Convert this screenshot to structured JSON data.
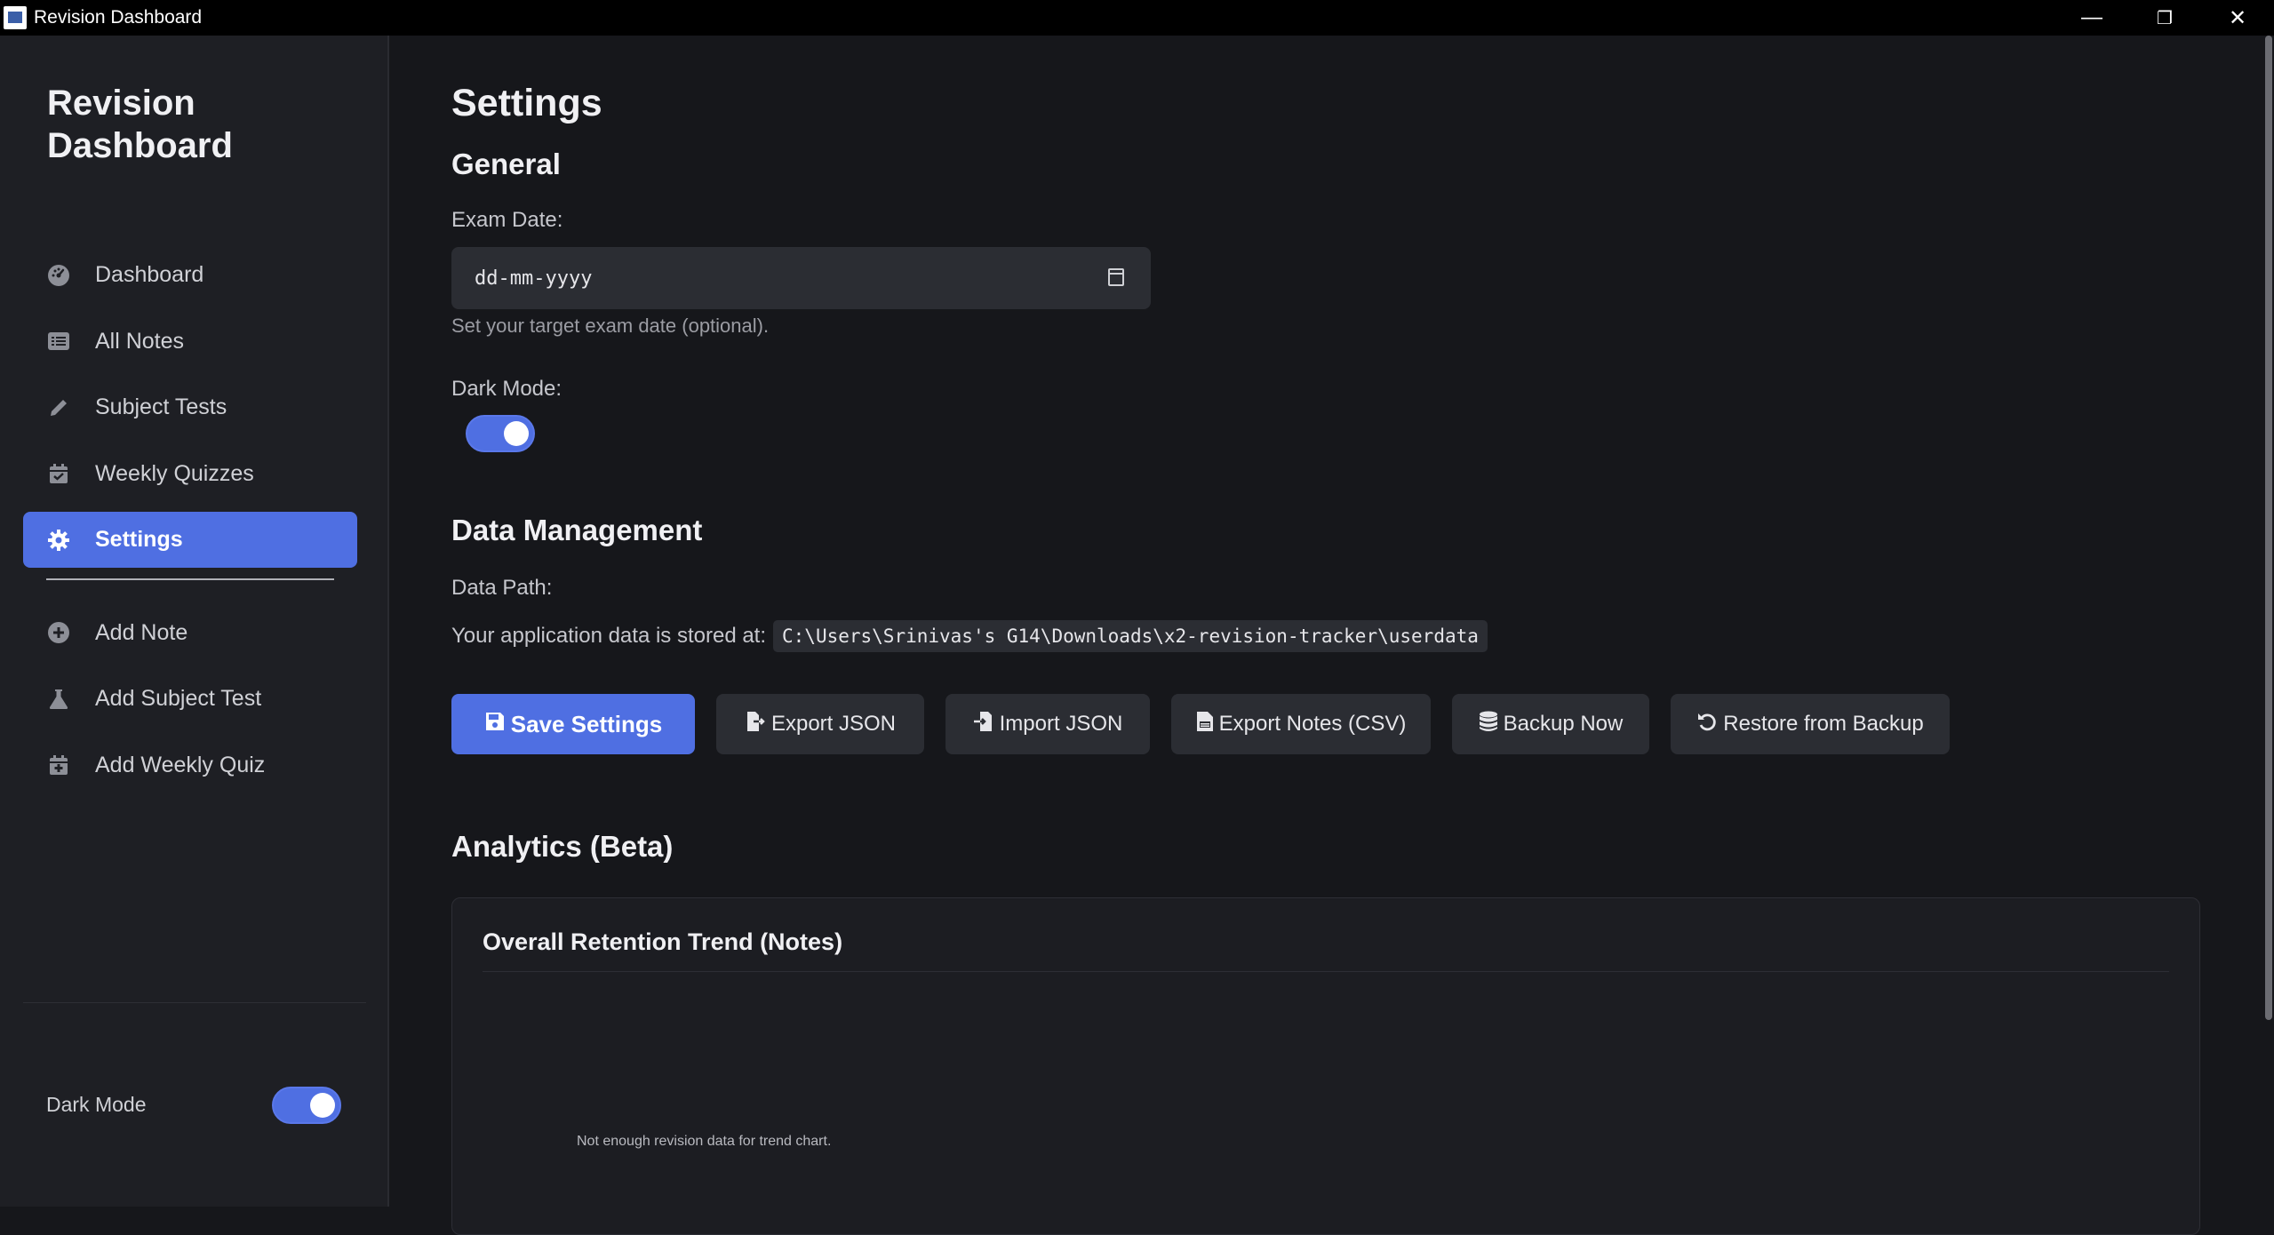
{
  "window": {
    "title": "Revision Dashboard",
    "controls": {
      "minimize": "—",
      "restore": "❐",
      "close": "✕"
    }
  },
  "sidebar": {
    "brand": "Revision Dashboard",
    "items": [
      {
        "label": "Dashboard",
        "icon": "gauge-icon"
      },
      {
        "label": "All Notes",
        "icon": "list-icon"
      },
      {
        "label": "Subject Tests",
        "icon": "pencil-icon"
      },
      {
        "label": "Weekly Quizzes",
        "icon": "calendar-check-icon"
      },
      {
        "label": "Settings",
        "icon": "gear-icon",
        "active": true
      },
      {
        "label": "Add Note",
        "icon": "plus-circle-icon"
      },
      {
        "label": "Add Subject Test",
        "icon": "flask-icon"
      },
      {
        "label": "Add Weekly Quiz",
        "icon": "calendar-plus-icon"
      }
    ],
    "dark_mode_label": "Dark Mode",
    "dark_mode_on": true
  },
  "settings": {
    "title": "Settings",
    "general": {
      "heading": "General",
      "exam_date_label": "Exam Date:",
      "exam_date_placeholder": "dd-mm-yyyy",
      "exam_date_hint": "Set your target exam date (optional).",
      "dark_mode_label": "Dark Mode:",
      "dark_mode_on": true
    },
    "data_management": {
      "heading": "Data Management",
      "path_label": "Data Path:",
      "path_prefix": "Your application data is stored at:",
      "path_value": "C:\\Users\\Srinivas's G14\\Downloads\\x2-revision-tracker\\userdata"
    },
    "buttons": {
      "save": "Save Settings",
      "export_json": "Export JSON",
      "import_json": "Import JSON",
      "export_csv": "Export Notes (CSV)",
      "backup": "Backup Now",
      "restore": "Restore from Backup"
    },
    "analytics": {
      "heading": "Analytics (Beta)",
      "card_title": "Overall Retention Trend (Notes)",
      "empty_message": "Not enough revision data for trend chart."
    }
  },
  "colors": {
    "accent": "#4f6fe2",
    "background": "#16171b",
    "sidebar": "#1e1f24",
    "input": "#2b2d33"
  }
}
